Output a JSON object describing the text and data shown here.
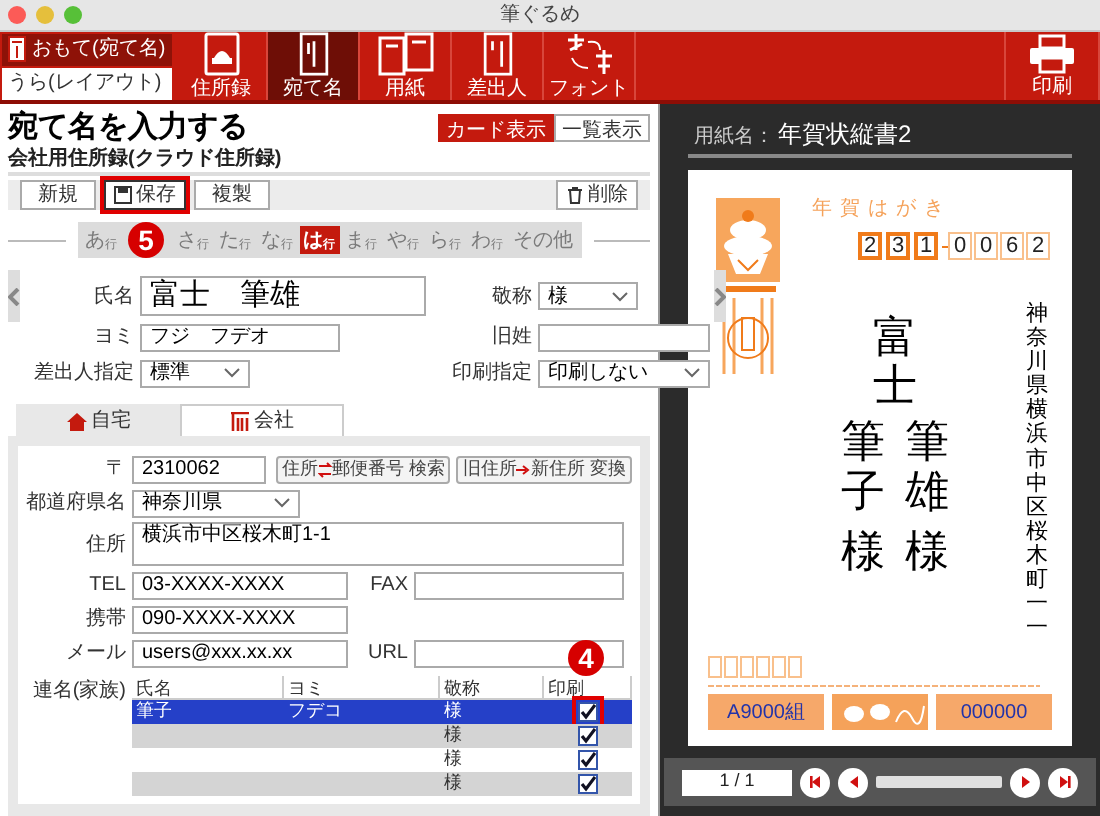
{
  "window": {
    "title": "筆ぐるめ"
  },
  "side_switch": [
    {
      "label": "おもて(宛て名)",
      "selected": true
    },
    {
      "label": "うら(レイアウト)",
      "selected": false
    }
  ],
  "toolbar": [
    {
      "label": "住所録",
      "kind": "book",
      "selected": false
    },
    {
      "label": "宛て名",
      "kind": "addressee",
      "selected": true
    },
    {
      "label": "用紙",
      "kind": "paper",
      "selected": false
    },
    {
      "label": "差出人",
      "kind": "sender",
      "selected": false
    },
    {
      "label": "フォント",
      "kind": "font",
      "selected": false
    },
    {
      "label": "印刷",
      "kind": "print",
      "selected": false
    }
  ],
  "page": {
    "title": "宛て名を入力する",
    "subtitle": "会社用住所録(クラウド住所録)"
  },
  "view_toggle": [
    {
      "label": "カード表示",
      "selected": true
    },
    {
      "label": "一覧表示",
      "selected": false
    }
  ],
  "actions": [
    {
      "label": "新規",
      "kind": "plain"
    },
    {
      "label": "保存",
      "kind": "save",
      "callout": "5"
    },
    {
      "label": "複製",
      "kind": "plain"
    },
    {
      "label": "削除",
      "kind": "delete"
    }
  ],
  "kana_index": [
    {
      "kind": "kana",
      "label": "あ",
      "suffix": "行",
      "selected": false
    },
    {
      "kind": "covered"
    },
    {
      "kind": "kana",
      "label": "さ",
      "suffix": "行",
      "selected": false
    },
    {
      "kind": "kana",
      "label": "た",
      "suffix": "行",
      "selected": false
    },
    {
      "kind": "kana",
      "label": "な",
      "suffix": "行",
      "selected": false
    },
    {
      "kind": "kana",
      "label": "は",
      "suffix": "行",
      "selected": true
    },
    {
      "kind": "kana",
      "label": "ま",
      "suffix": "行",
      "selected": false
    },
    {
      "kind": "kana",
      "label": "や",
      "suffix": "行",
      "selected": false
    },
    {
      "kind": "kana",
      "label": "ら",
      "suffix": "行",
      "selected": false
    },
    {
      "kind": "kana",
      "label": "わ",
      "suffix": "行",
      "selected": false
    },
    {
      "kind": "other",
      "label": "その他",
      "selected": false
    }
  ],
  "card": {
    "name_label": "氏名",
    "name": "富士　筆雄",
    "honorific_label": "敬称",
    "honorific": "様",
    "reading_label": "ヨミ",
    "reading": "フジ　フデオ",
    "maiden_label": "旧姓",
    "sender_label": "差出人指定",
    "sender": "標準",
    "print_label": "印刷指定",
    "print": "印刷しない"
  },
  "address_tabs": [
    {
      "label": "自宅",
      "kind": "home",
      "selected": false
    },
    {
      "label": "会社",
      "kind": "office",
      "selected": true
    }
  ],
  "address": {
    "postal_label": "〒",
    "postal": "2310062",
    "lookup_button": {
      "from": "住所",
      "to": "郵便番号 検索"
    },
    "convert_button": {
      "from": "旧住所",
      "to": "新住所 変換"
    },
    "prefecture_label": "都道府県名",
    "prefecture": "神奈川県",
    "address_label": "住所",
    "address": "横浜市中区桜木町1-1",
    "tel_label": "TEL",
    "tel": "03-XXXX-XXXX",
    "fax_label": "FAX",
    "mobile_label": "携帯",
    "mobile": "090-XXXX-XXXX",
    "email_label": "メール",
    "email": "users@xxx.xx.xx",
    "url_label": "URL"
  },
  "family": {
    "label": "連名(家族)",
    "columns": [
      "氏名",
      "ヨミ",
      "敬称",
      "印刷"
    ],
    "print_callout": "4",
    "rows": [
      {
        "name": "筆子",
        "reading": "フデコ",
        "honorific": "様",
        "print": true,
        "selected": true
      },
      {
        "honorific": "様",
        "print": true,
        "selected": false
      },
      {
        "honorific": "様",
        "print": true,
        "selected": false
      },
      {
        "honorific": "様",
        "print": true,
        "selected": false
      }
    ]
  },
  "preview": {
    "paper_label": "用紙名：",
    "paper_name": "年賀状縦書2",
    "postcard_label": "年賀はがき",
    "postal_digits": [
      "2",
      "3",
      "1",
      "0",
      "0",
      "6",
      "2"
    ],
    "address": "神奈川県横浜市中区桜木町一一",
    "surname": "富士",
    "names": [
      {
        "given": "筆子",
        "honorific": "様"
      },
      {
        "given": "筆雄",
        "honorific": "様"
      }
    ],
    "lottery_group": "A9000組",
    "lottery_number": "000000",
    "pager": "1 / 1"
  }
}
